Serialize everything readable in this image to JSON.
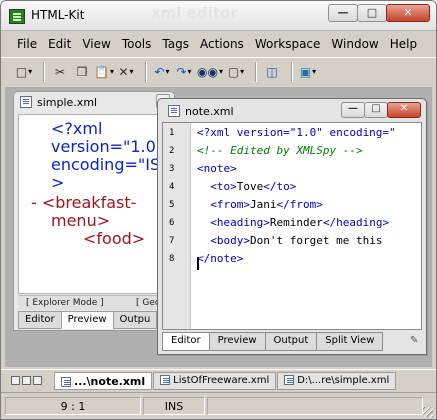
{
  "app": {
    "title": "HTML-Kit",
    "ghost_title": "xml editor"
  },
  "menu": [
    "File",
    "Edit",
    "View",
    "Tools",
    "Tags",
    "Actions",
    "Workspace",
    "Window",
    "Help"
  ],
  "toolbar_icons": [
    "select-icon",
    "cut-icon",
    "paste-icon",
    "delete-icon",
    "undo-icon",
    "redo-icon",
    "find-icon",
    "new-document-icon",
    "window-layout-icon",
    "monitor-icon"
  ],
  "simple_window": {
    "title": "simple.xml",
    "preview_lines": [
      "<?xml",
      "version=\"1.0\"",
      "encoding=\"ISO",
      ">",
      "- <breakfast-",
      "menu>",
      "<food>"
    ],
    "status_left": "[ Explorer Mode ]",
    "status_right": "[ Geck",
    "tabs": [
      "Editor",
      "Preview",
      "Outpu"
    ]
  },
  "note_window": {
    "title": "note.xml",
    "line_numbers": [
      "1",
      "2",
      "3",
      "4",
      "5",
      "6",
      "7",
      "8"
    ],
    "code": {
      "l1": "<?xml version=\"1.0\" encoding=\"",
      "l2": "<!-- Edited by XMLSpy -->",
      "l3": "<note>",
      "l4a": "  <to>",
      "l4b": "Tove",
      "l4c": "</to>",
      "l5a": "  <from>",
      "l5b": "Jani",
      "l5c": "</from>",
      "l6a": "  <heading>",
      "l6b": "Reminder",
      "l6c": "</heading>",
      "l7a": "  <body>",
      "l7b": "Don't forget me this",
      "l8": "</note>"
    },
    "tabs": [
      "Editor",
      "Preview",
      "Output",
      "Split View"
    ]
  },
  "file_tabs": [
    "...\\note.xml",
    "ListOfFreeware.xml",
    "D:\\...re\\simple.xml"
  ],
  "status": {
    "position": "9 : 1",
    "mode": "INS"
  }
}
